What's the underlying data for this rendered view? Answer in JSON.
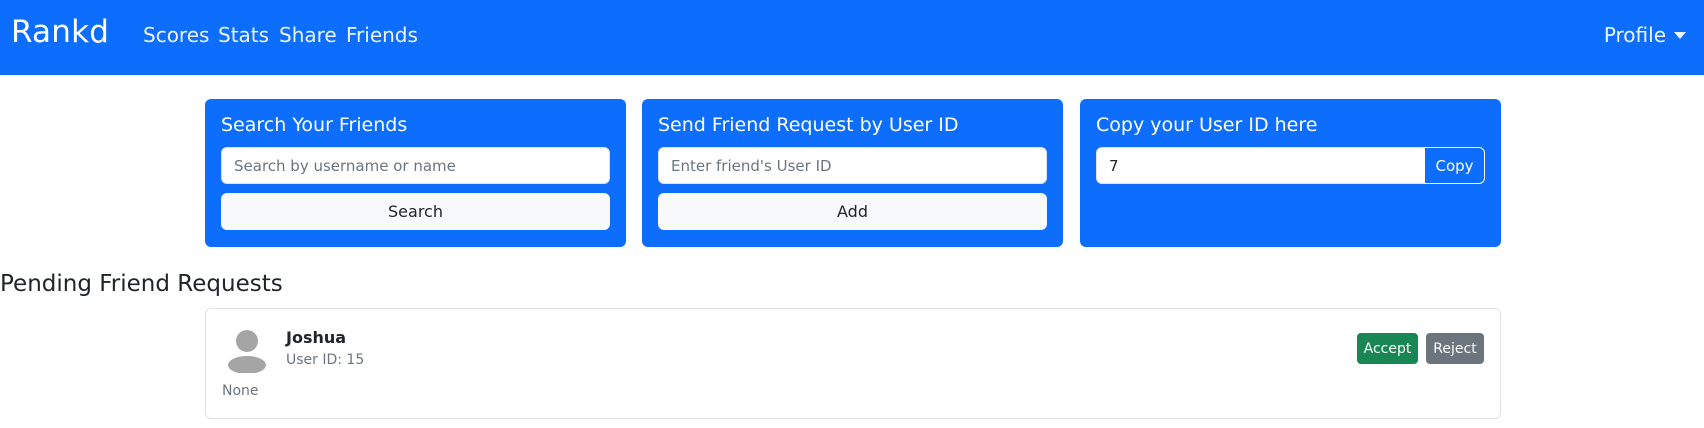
{
  "navbar": {
    "brand": "Rankd",
    "links": [
      "Scores",
      "Stats",
      "Share",
      "Friends"
    ],
    "profile": "Profile",
    "bg_color": "#0d6efd"
  },
  "search_card": {
    "title": "Search Your Friends",
    "input_placeholder": "Search by username or name",
    "button_label": "Search"
  },
  "request_card": {
    "title": "Send Friend Request by User ID",
    "input_placeholder": "Enter friend's User ID",
    "button_label": "Add"
  },
  "copy_card": {
    "title": "Copy your User ID here",
    "user_id_value": "7",
    "button_label": "Copy"
  },
  "pending": {
    "title": "Pending Friend Requests",
    "requests": [
      {
        "name": "Joshua",
        "user_id": "User ID: 15",
        "note": "None",
        "accept_label": "Accept",
        "reject_label": "Reject"
      }
    ]
  },
  "colors": {
    "primary": "#0d6efd",
    "success": "#198754",
    "secondary": "#6c757d"
  }
}
